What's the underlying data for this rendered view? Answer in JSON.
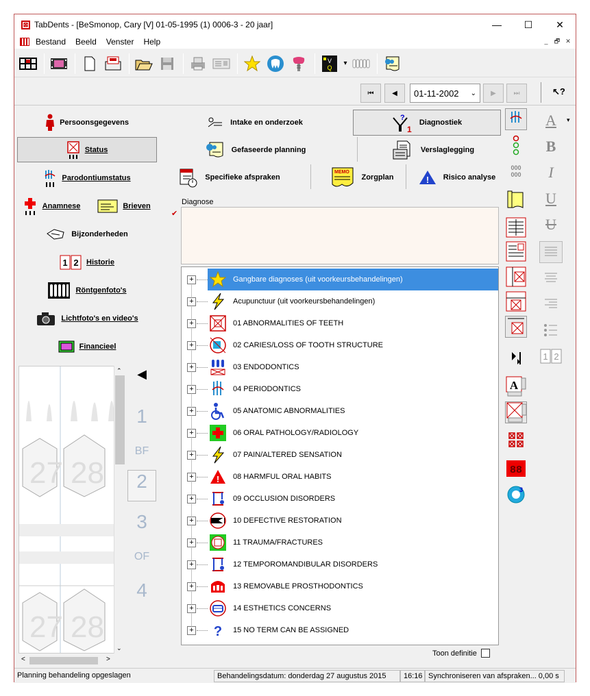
{
  "window": {
    "title": "TabDents - [BeSmonop, Cary [V] 01-05-1995 (1) 0006-3 - 20 jaar]",
    "minimize": "—",
    "maximize": "☐",
    "close": "✕"
  },
  "menu": [
    "Bestand",
    "Beeld",
    "Venster",
    "Help"
  ],
  "mdi_controls": [
    "_",
    "🗗",
    "✕"
  ],
  "nav": {
    "first": "⏮",
    "prev": "◀",
    "date": "01-11-2002",
    "date_dropdown": "⌄",
    "next": "▶",
    "last": "⏭",
    "help": "↖?"
  },
  "left_buttons": {
    "persoonsgegevens": "Persoonsgegevens",
    "status": "Status",
    "parodontiumstatus": "Parodontiumstatus",
    "anamnese": "Anamnese",
    "brieven": "Brieven",
    "bijzonderheden": "Bijzonderheden",
    "historie": "Historie",
    "rontgenfotos": "Röntgenfoto's",
    "lichtfotos": "Lichtfoto's en video's",
    "financieel": "Financieel"
  },
  "tooth_numbers": {
    "n1": "1",
    "bf": "BF",
    "n2": "2",
    "n3": "3",
    "of": "OF",
    "n4": "4",
    "t27": "27",
    "t28": "28"
  },
  "tabs": {
    "intake": "Intake en onderzoek",
    "diagnostiek": "Diagnostiek",
    "gefaseerde": "Gefaseerde planning",
    "verslaglegging": "Verslaglegging",
    "specifieke": "Specifieke afspraken",
    "zorgplan": "Zorgplan",
    "risico": "Risico analyse"
  },
  "diagnose_label": "Diagnose",
  "diagnose_value": "",
  "tree_items": [
    {
      "label": "Gangbare diagnoses (uit voorkeursbehandelingen)",
      "icon": "star-icon",
      "selected": true
    },
    {
      "label": "Acupunctuur (uit voorkeursbehandelingen)",
      "icon": "lightning-icon"
    },
    {
      "label": "01 ABNORMALITIES OF TEETH",
      "icon": "tooth-grid-icon"
    },
    {
      "label": "02 CARIES/LOSS OF TOOTH STRUCTURE",
      "icon": "caries-icon"
    },
    {
      "label": "03 ENDODONTICS",
      "icon": "endo-icon"
    },
    {
      "label": "04 PERIODONTICS",
      "icon": "perio-icon"
    },
    {
      "label": "05 ANATOMIC ABNORMALITIES",
      "icon": "wheelchair-icon"
    },
    {
      "label": "06 ORAL PATHOLOGY/RADIOLOGY",
      "icon": "cross-icon"
    },
    {
      "label": "07 PAIN/ALTERED SENSATION",
      "icon": "lightning-icon"
    },
    {
      "label": "08 HARMFUL ORAL HABITS",
      "icon": "warning-icon"
    },
    {
      "label": "09 OCCLUSION DISORDERS",
      "icon": "occlusion-icon"
    },
    {
      "label": "10 DEFECTIVE RESTORATION",
      "icon": "restoration-icon"
    },
    {
      "label": "11 TRAUMA/FRACTURES",
      "icon": "trauma-icon"
    },
    {
      "label": "12 TEMPOROMANDIBULAR DISORDERS",
      "icon": "tmj-icon"
    },
    {
      "label": "13 REMOVABLE PROSTHODONTICS",
      "icon": "denture-icon"
    },
    {
      "label": "14 ESTHETICS CONCERNS",
      "icon": "esthetics-icon"
    },
    {
      "label": "15 NO TERM CAN BE ASSIGNED",
      "icon": "question-icon"
    }
  ],
  "toon_definitie": "Toon definitie",
  "status": {
    "left": "Planning behandeling opgeslagen",
    "date": "Behandelingsdatum: donderdag 27 augustus 2015",
    "time": "16:16",
    "sync": "Synchroniseren van afspraken... 0,00 s"
  },
  "colors": {
    "selection": "#3d8ee0",
    "accent_red": "#cc0000",
    "tooth_number": "#a8b8cc"
  }
}
